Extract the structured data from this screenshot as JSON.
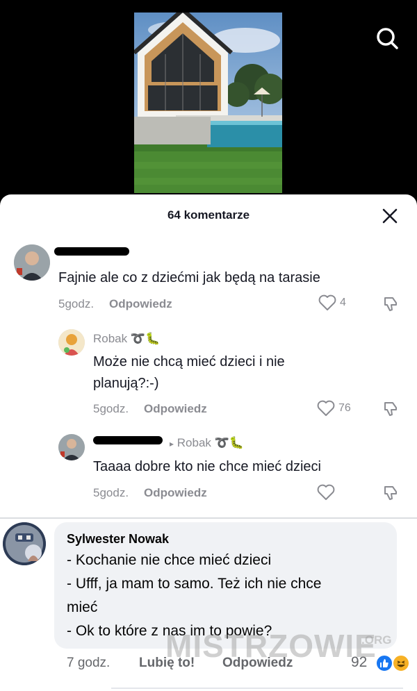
{
  "tiktok": {
    "header_title": "64 komentarze",
    "comments": [
      {
        "text": "Fajnie ale co z dziećmi jak będą na tarasie",
        "time": "5godz.",
        "reply_label": "Odpowiedz",
        "likes": "4"
      }
    ],
    "replies": [
      {
        "username": "Robak",
        "text_line1": "Może nie chcą mieć dzieci i nie",
        "text_line2": "planują?:-)",
        "time": "5godz.",
        "reply_label": "Odpowiedz",
        "likes": "76"
      },
      {
        "reply_to_arrow": "▸",
        "reply_to": "Robak",
        "text": "Taaaa dobre kto nie chce mieć dzieci",
        "time": "5godz.",
        "reply_label": "Odpowiedz"
      }
    ],
    "username_emoji": "➰🐛"
  },
  "facebook": {
    "author": "Sylwester Nowak",
    "lines": [
      "- Kochanie nie chce mieć dzieci",
      "- Ufff, ja mam to samo. Też ich nie chce",
      "mieć",
      "- Ok to które z nas im to powie?"
    ],
    "time": "7 godz.",
    "like_label": "Lubię to!",
    "reply_label": "Odpowiedz",
    "reaction_count": "92",
    "reactions": [
      "like-icon",
      "laugh-icon"
    ]
  },
  "watermark": {
    "text": "MISTRZOWIE",
    "org": ".ORG"
  },
  "colors": {
    "tiktok_gray": "#8a8b91",
    "fb_bubble": "#f0f2f5",
    "fb_blue": "#1877f2",
    "laugh_yellow": "#f7b125"
  }
}
